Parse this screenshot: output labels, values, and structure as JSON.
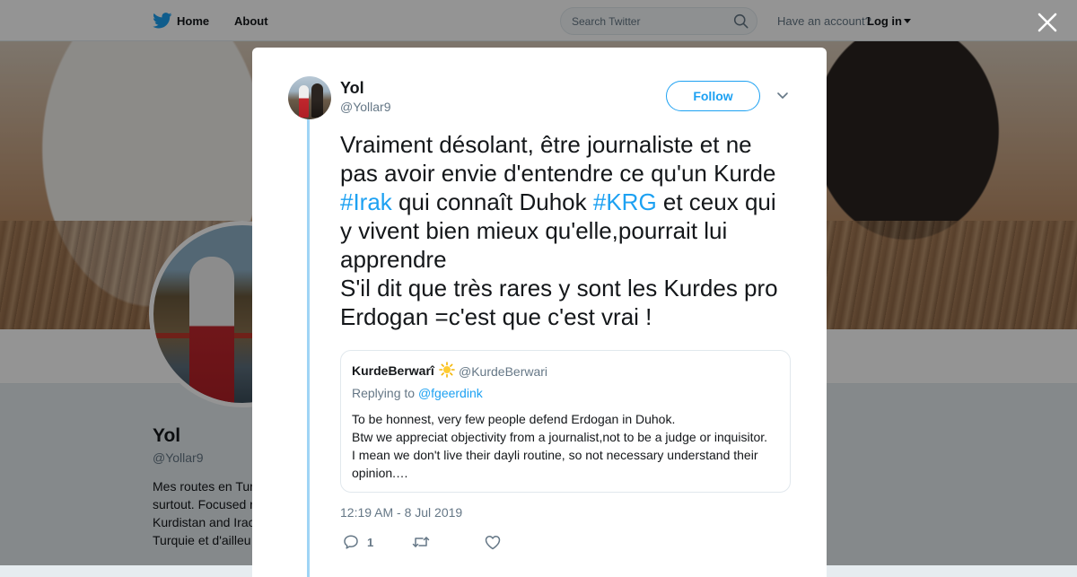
{
  "nav": {
    "home_label": "Home",
    "about_label": "About",
    "search_placeholder": "Search Twitter",
    "have_account": "Have an account?",
    "login_label": "Log in"
  },
  "background_profile": {
    "name": "Yol",
    "handle": "@Yollar9",
    "bio_lines": [
      "Mes routes en Tur",
      "surtout. Focused r",
      "Kurdistan and Irac",
      "Turquie et d'ailleu"
    ]
  },
  "tweet": {
    "author_name": "Yol",
    "author_handle": "@Yollar9",
    "follow_label": "Follow",
    "text_segments": [
      "Vraiment désolant, être journaliste et ne pas avoir envie d'entendre ce qu'un Kurde ",
      "#Irak",
      " qui connaît Duhok ",
      "#KRG",
      " et ceux qui y vivent bien mieux qu'elle,pourrait lui apprendre",
      "S'il dit que très rares y sont les Kurdes pro Erdogan =c'est que c'est vrai !"
    ],
    "timestamp": "12:19 AM - 8 Jul 2019",
    "reply_count": "1",
    "quote": {
      "name": "KurdeBerwarî",
      "handle": "@KurdeBerwari",
      "replying_prefix": "Replying to",
      "replying_to": "@fgeerdink",
      "lines": [
        "To be honnest, very few people defend Erdogan in Duhok.",
        "Btw we appreciat objectivity from a journalist,not to be a judge or inquisitor.",
        "I mean we don't live their dayli routine, so not necessary understand their opinion.…"
      ]
    }
  },
  "colors": {
    "twitter_blue": "#1da1f2",
    "text_primary": "#14171a",
    "text_secondary": "#657786",
    "thread_line": "#9fd4f5"
  },
  "icons": [
    "twitter-logo-icon",
    "search-icon",
    "close-icon",
    "chevron-down-icon",
    "sun-emoji-icon",
    "reply-icon",
    "retweet-icon",
    "like-icon"
  ]
}
